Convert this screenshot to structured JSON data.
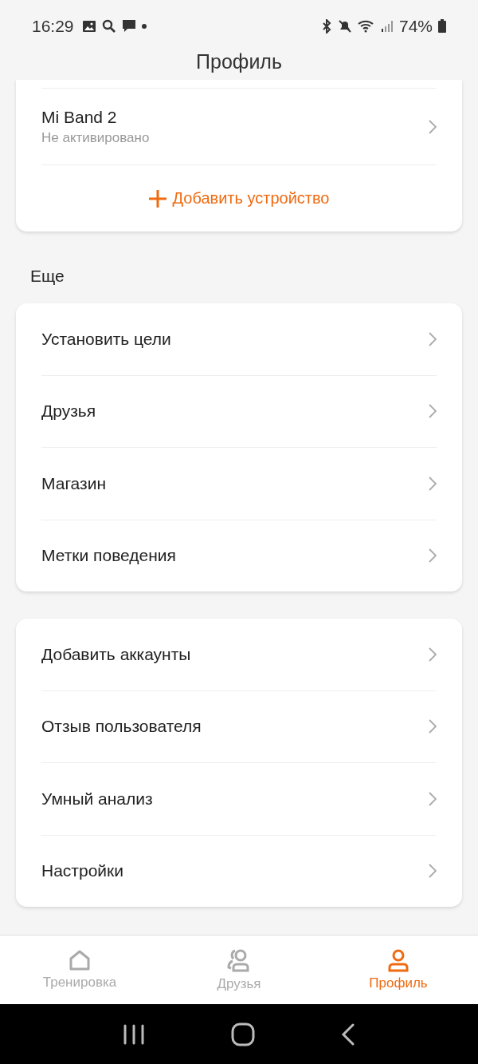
{
  "status_bar": {
    "time": "16:29",
    "battery": "74%"
  },
  "header": {
    "title": "Профиль"
  },
  "device_card": {
    "device": {
      "name": "Mi Band 2",
      "status": "Не активировано"
    },
    "add_label": "Добавить устройство"
  },
  "more_section": {
    "title": "Еще",
    "items": [
      "Установить цели",
      "Друзья",
      "Магазин",
      "Метки поведения"
    ]
  },
  "second_section": {
    "items": [
      "Добавить аккаунты",
      "Отзыв пользователя",
      "Умный анализ",
      "Настройки"
    ]
  },
  "bottom_nav": [
    {
      "kind": "home",
      "label": "Тренировка",
      "selected": false
    },
    {
      "kind": "friends",
      "label": "Друзья",
      "selected": false
    },
    {
      "kind": "profile",
      "label": "Профиль",
      "selected": true
    }
  ]
}
